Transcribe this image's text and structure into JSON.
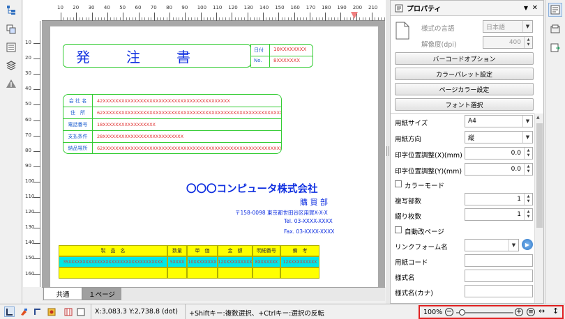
{
  "ruler": {
    "h_ticks": [
      "10",
      "20",
      "30",
      "40",
      "50",
      "60",
      "70",
      "80",
      "90",
      "100",
      "110",
      "120",
      "130",
      "140",
      "150",
      "160",
      "170",
      "180",
      "190",
      "200",
      "210"
    ],
    "v_ticks": [
      "10",
      "20",
      "30",
      "40",
      "50",
      "60",
      "70",
      "80",
      "90",
      "100",
      "110",
      "120",
      "130",
      "140",
      "150",
      "160"
    ]
  },
  "doc": {
    "title": "発　　注　　書",
    "date_label": "日付",
    "date_value": "10XXXXXXXX",
    "no_label": "No.",
    "no_value": "8XXXXXXX",
    "info_rows": [
      {
        "label": "会 社 名",
        "value": "42XXXXXXXXXXXXXXXXXXXXXXXXXXXXXXXXXXXXXXXXX"
      },
      {
        "label": "住　所",
        "value": "62XXXXXXXXXXXXXXXXXXXXXXXXXXXXXXXXXXXXXXXXXXXXXXXXXXXXXXXXXXXXXXX"
      },
      {
        "label": "電話番号",
        "value": "18XXXXXXXXXXXXXXXXX"
      },
      {
        "label": "支払条件",
        "value": "28XXXXXXXXXXXXXXXXXXXXXXXXXX"
      },
      {
        "label": "納品場所",
        "value": "62XXXXXXXXXXXXXXXXXXXXXXXXXXXXXXXXXXXXXXXXXXXXXXXXXXXXXXXXXXXXXXX"
      }
    ],
    "company": "〇〇〇コンピュータ株式会社",
    "dept": "購 買 部",
    "address": "〒158-0098 東京都世田谷区用賀X-X-X",
    "tel": "Tel. 03-XXXX-XXXX",
    "fax": "Fax. 03-XXXX-XXXX",
    "table_headers": [
      "製　品　名",
      "数量",
      "単　価",
      "金　額",
      "明細番号",
      "備　考"
    ],
    "table_row": [
      "35XXXXXXXXXXXXXXXXXXXXXXXXXXXXXXXXX",
      "5XXXX",
      "10XXXXXXXX",
      "12XXXXXXXXXX",
      "8XXXXXXX",
      "12XXXXXXXXXX"
    ]
  },
  "tabs": [
    "共通",
    "１ページ"
  ],
  "props": {
    "title": "プロパティ",
    "lang_label": "様式の言語",
    "lang_value": "日本語",
    "dpi_label": "解像度(dpi)",
    "dpi_value": "400",
    "buttons": [
      "バーコードオプション",
      "カラーパレット設定",
      "ページカラー設定",
      "フォント選択"
    ],
    "paper_size_label": "用紙サイズ",
    "paper_size_value": "A4",
    "orientation_label": "用紙方向",
    "orientation_value": "縦",
    "adj_x_label": "印字位置調整(X)(mm)",
    "adj_x_value": "0.0",
    "adj_y_label": "印字位置調整(Y)(mm)",
    "adj_y_value": "0.0",
    "color_mode_label": "カラーモード",
    "copies_label": "複写部数",
    "copies_value": "1",
    "binding_label": "綴り枚数",
    "binding_value": "1",
    "auto_page_label": "自動改ページ",
    "link_form_label": "リンクフォーム名",
    "paper_code_label": "用紙コード",
    "form_name_label": "様式名",
    "form_kana_label": "様式名(カナ)"
  },
  "status": {
    "coords": "X:3,083.3 Y:2,738.8 (dot)",
    "hint": "+Shiftキー:複数選択、+Ctrlキー:選択の反転",
    "zoom": "100%",
    "zoom_fraction": 0.1
  },
  "colors": {
    "accent_red": "#e02020",
    "green": "#33cc33",
    "blue": "#1030e0"
  }
}
